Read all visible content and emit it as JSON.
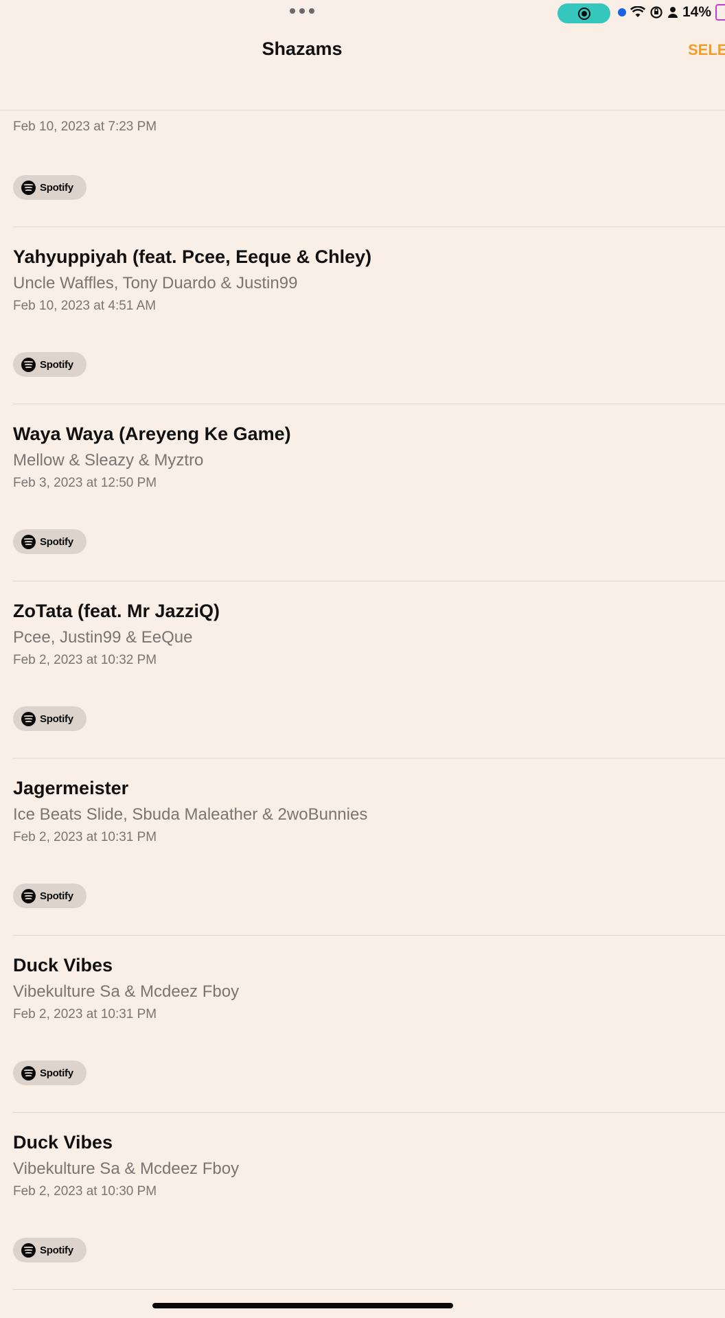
{
  "status_bar": {
    "battery_text": "14%"
  },
  "header": {
    "title": "Shazams",
    "select_label": "SELE"
  },
  "partial_item": {
    "date": "Feb 10, 2023 at 7:23 PM",
    "badge": "Spotify"
  },
  "items": [
    {
      "title": "Yahyuppiyah (feat. Pcee, Eeque & Chley)",
      "artist": "Uncle Waffles, Tony Duardo & Justin99",
      "date": "Feb 10, 2023 at 4:51 AM",
      "badge": "Spotify"
    },
    {
      "title": "Waya Waya (Areyeng Ke Game)",
      "artist": "Mellow & Sleazy & Myztro",
      "date": "Feb 3, 2023 at 12:50 PM",
      "badge": "Spotify"
    },
    {
      "title": "ZoTata (feat. Mr JazziQ)",
      "artist": "Pcee, Justin99 & EeQue",
      "date": "Feb 2, 2023 at 10:32 PM",
      "badge": "Spotify"
    },
    {
      "title": "Jagermeister",
      "artist": "Ice Beats Slide, Sbuda Maleather & 2woBunnies",
      "date": "Feb 2, 2023 at 10:31 PM",
      "badge": "Spotify"
    },
    {
      "title": "Duck Vibes",
      "artist": "Vibekulture Sa & Mcdeez Fboy",
      "date": "Feb 2, 2023 at 10:31 PM",
      "badge": "Spotify"
    },
    {
      "title": "Duck Vibes",
      "artist": "Vibekulture Sa & Mcdeez Fboy",
      "date": "Feb 2, 2023 at 10:30 PM",
      "badge": "Spotify"
    }
  ],
  "colors": {
    "background": "#f9efe6",
    "accent": "#f29c2a",
    "record_pill": "#35c6bd",
    "secondary_text": "#7a7571"
  }
}
